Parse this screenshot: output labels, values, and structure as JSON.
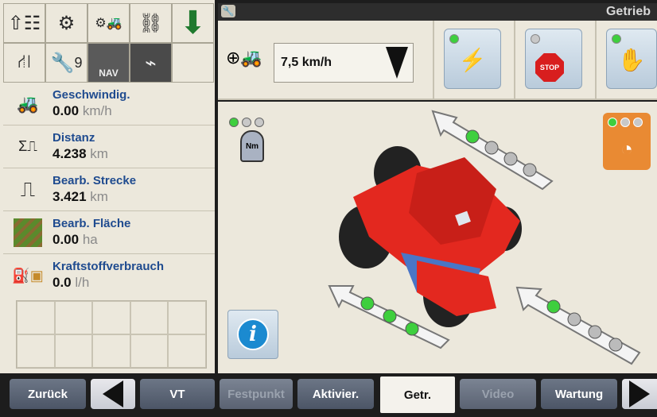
{
  "top_strip": {
    "title": "Getrieb"
  },
  "left_icons": [
    {
      "name": "menu-grid-icon",
      "glyph": "⇧☷"
    },
    {
      "name": "gear-icon",
      "glyph": "⚙"
    },
    {
      "name": "tractor-settings-icon",
      "glyph": "⚙🚜"
    },
    {
      "name": "tool-implement-icon",
      "glyph": "⛓"
    },
    {
      "name": "down-arrow-icon",
      "glyph": "⬇"
    },
    {
      "name": "road-icon",
      "glyph": "⛙"
    },
    {
      "name": "wrench-icon",
      "glyph": "🔧9"
    },
    {
      "name": "nav-icon",
      "glyph": "NAV"
    },
    {
      "name": "usb-icon",
      "glyph": "⌁"
    },
    {
      "name": "empty-slot-icon",
      "glyph": ""
    }
  ],
  "info_rows": [
    {
      "label": "Geschwindig.",
      "value": "0.00",
      "unit": "km/h",
      "icon": "speed-icon"
    },
    {
      "label": "Distanz",
      "value": "4.238",
      "unit": "km",
      "icon": "distance-icon"
    },
    {
      "label": "Bearb. Strecke",
      "value": "3.421",
      "unit": "km",
      "icon": "worked-distance-icon"
    },
    {
      "label": "Bearb. Fläche",
      "value": "0.00",
      "unit": "ha",
      "icon": "field-icon"
    },
    {
      "label": "Kraftstoffverbrauch",
      "value": "0.0",
      "unit": "l/h",
      "icon": "fuel-icon"
    }
  ],
  "toolbar": {
    "speed_value": "7,5 km/h"
  },
  "bottom": {
    "back": "Zurück",
    "vt": "VT",
    "festpunkt": "Festpunkt",
    "aktivier": "Aktivier.",
    "getr": "Getr.",
    "video": "Video",
    "wartung": "Wartung"
  },
  "colors": {
    "tractor": "#e3281f",
    "led_on": "#3ecf3e",
    "label_blue": "#1f4b8f"
  }
}
